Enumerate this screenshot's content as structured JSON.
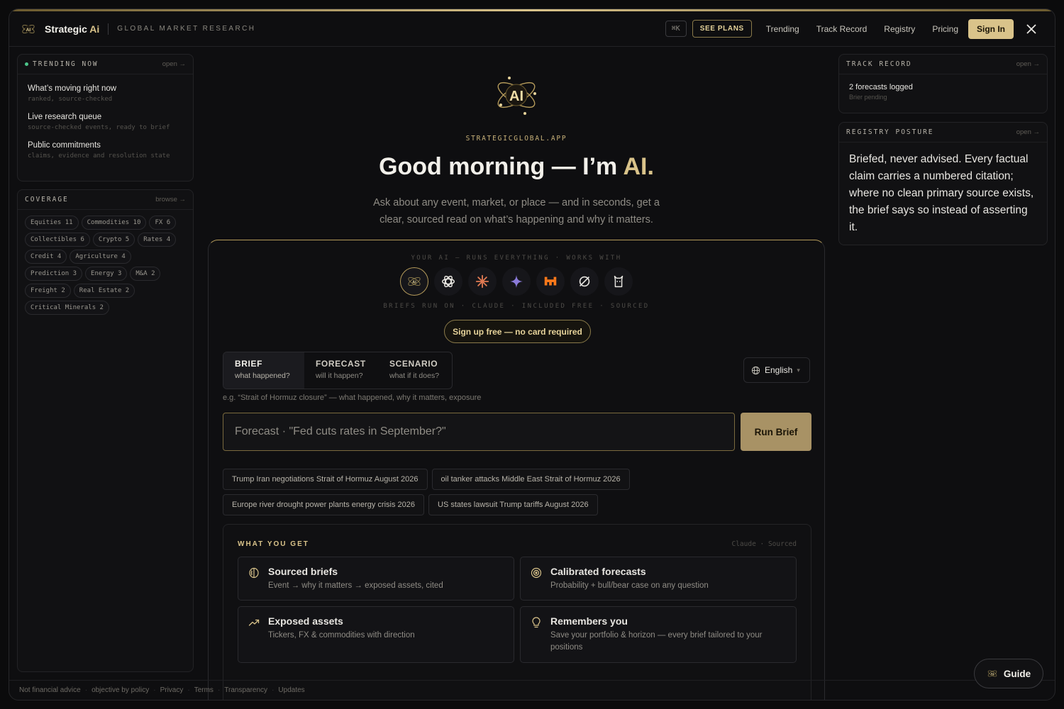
{
  "header": {
    "brand": "Strategic",
    "brand_ai": "Ai",
    "tagline": "GLOBAL MARKET RESEARCH",
    "shortcut": "⌘K",
    "see_plans": "SEE PLANS",
    "nav": [
      "Trending",
      "Track Record",
      "Registry",
      "Pricing"
    ],
    "sign_in": "Sign In"
  },
  "trending": {
    "title": "TRENDING NOW",
    "link": "open →",
    "items": [
      {
        "title": "What’s moving right now",
        "sub": "ranked, source-checked"
      },
      {
        "title": "Live research queue",
        "sub": "source-checked events, ready to brief"
      },
      {
        "title": "Public commitments",
        "sub": "claims, evidence and resolution state"
      }
    ]
  },
  "coverage": {
    "title": "COVERAGE",
    "link": "browse →",
    "chips": [
      "Equities 11",
      "Commodities 10",
      "FX 6",
      "Collectibles 6",
      "Crypto 5",
      "Rates 4",
      "Credit 4",
      "Agriculture 4",
      "Prediction 3",
      "Energy 3",
      "M&A 2",
      "Freight 2",
      "Real Estate 2",
      "Critical Minerals 2"
    ]
  },
  "hero": {
    "domain": "STRATEGICGLOBAL.APP",
    "greeting": "Good morning — I’m ",
    "greeting_ai": "AI.",
    "subtitle": "Ask about any event, market, or place — and in seconds, get a clear, sourced read on what’s happening and why it matters."
  },
  "card": {
    "works_with": "YOUR AI — RUNS EVERYTHING · WORKS WITH",
    "runs_on": "BRIEFS RUN ON · CLAUDE · INCLUDED FREE · SOURCED",
    "signup": "Sign up free — no card required",
    "modes": [
      {
        "label": "BRIEF",
        "desc": "what happened?"
      },
      {
        "label": "FORECAST",
        "desc": "will it happen?"
      },
      {
        "label": "SCENARIO",
        "desc": "what if it does?"
      }
    ],
    "language": "English",
    "example": "e.g. “Strait of Hormuz closure” — what happened, why it matters, exposure",
    "search_placeholder": "Forecast · \"Fed cuts rates in September?\"",
    "run": "Run Brief",
    "suggestions": [
      "Trump Iran negotiations Strait of Hormuz August 2026",
      "oil tanker attacks Middle East Strait of Hormuz 2026",
      "Europe river drought power plants energy crisis 2026",
      "US states lawsuit Trump tariffs August 2026"
    ],
    "wyg_title": "WHAT YOU GET",
    "wyg_right": "Claude · Sourced",
    "features": [
      {
        "title": "Sourced briefs",
        "desc": "Event → why it matters → exposed assets, cited"
      },
      {
        "title": "Calibrated forecasts",
        "desc": "Probability + bull/bear case on any question"
      },
      {
        "title": "Exposed assets",
        "desc": "Tickers, FX & commodities with direction"
      },
      {
        "title": "Remembers you",
        "desc": "Save your portfolio & horizon — every brief tailored to your positions"
      }
    ]
  },
  "track_record": {
    "title": "TRACK RECORD",
    "link": "open →",
    "main": "2 forecasts logged",
    "sub": "Brier pending"
  },
  "registry": {
    "title": "REGISTRY POSTURE",
    "link": "open →",
    "text": "Briefed, never advised. Every factual claim carries a numbered citation; where no clean primary source exists, the brief says so instead of asserting it."
  },
  "footer": [
    "Not financial advice",
    "objective by policy",
    "Privacy",
    "Terms",
    "Transparency",
    "Updates"
  ],
  "guide": "Guide",
  "colors": {
    "accent": "#d9c38a",
    "run_button": "#a89265",
    "live_dot": "#4cc48a"
  }
}
